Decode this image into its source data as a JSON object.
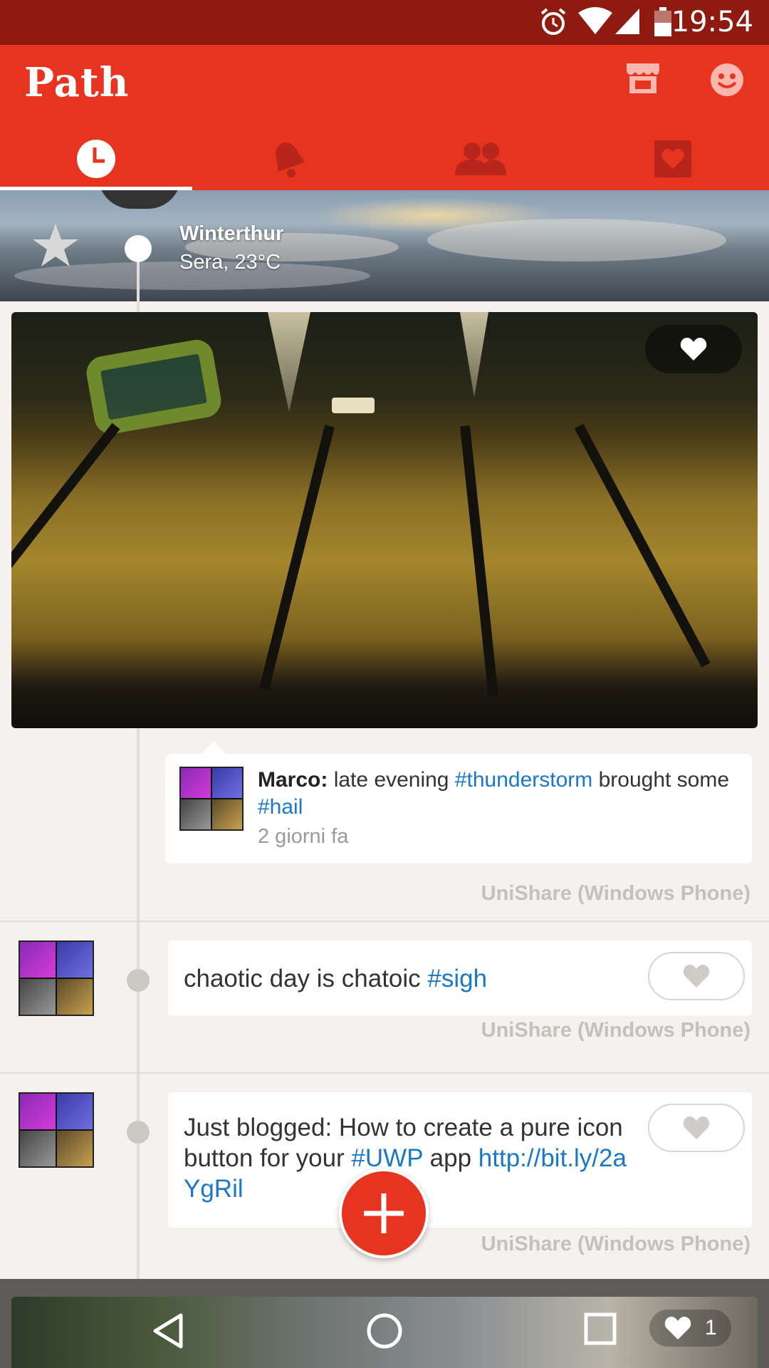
{
  "status_bar": {
    "time": "19:54",
    "icons": [
      "alarm-icon",
      "wifi-icon",
      "signal-icon",
      "battery-icon"
    ]
  },
  "app": {
    "logo": "Path"
  },
  "header_icons": [
    "shop-icon",
    "smiley-icon"
  ],
  "tabs": [
    {
      "name": "clock-icon",
      "selected": true
    },
    {
      "name": "bell-icon",
      "selected": false
    },
    {
      "name": "friends-icon",
      "selected": false
    },
    {
      "name": "love-box-icon",
      "selected": false
    }
  ],
  "cover": {
    "place": "Winterthur",
    "weather": "Sera, 23°C"
  },
  "photo_post": {
    "author": "Marco:",
    "text_before": " late evening ",
    "tag1": "#thunderstorm",
    "text_middle": " brought some ",
    "tag2": "#hail",
    "time": "2 giorni fa",
    "source": "UniShare (Windows Phone)"
  },
  "moments": [
    {
      "text": "chaotic day is chatoic ",
      "tag": "#sigh",
      "source": "UniShare (Windows Phone)"
    },
    {
      "text": "Just blogged: How to create a pure icon button for your ",
      "tag": "#UWP",
      "text_after": " app  ",
      "link": "http://bit.ly/2aYgRil",
      "source": "UniShare (Windows Phone)"
    }
  ],
  "bottom": {
    "like_count": "1"
  },
  "colors": {
    "brand": "#e63420",
    "status_bar": "#8f1a10",
    "link": "#1a78c8",
    "source_text": "#c4c0bc"
  }
}
